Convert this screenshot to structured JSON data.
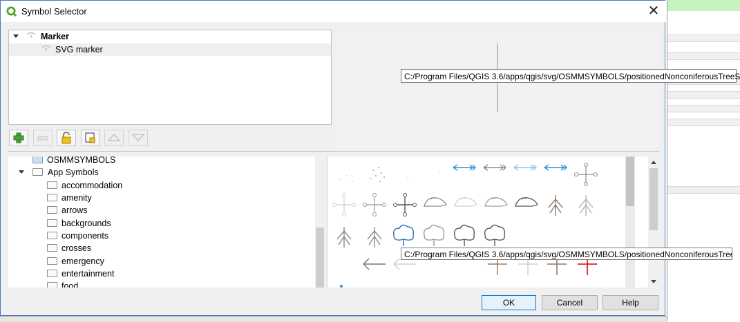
{
  "dialog": {
    "title": "Symbol Selector",
    "close_glyph": "✕"
  },
  "layer_tree": {
    "root_label": "Marker",
    "child_label": "SVG marker"
  },
  "toolbar": {
    "icons": [
      "add-layer-icon",
      "remove-layer-icon",
      "lock-icon",
      "duplicate-icon",
      "move-up-icon",
      "move-down-icon"
    ]
  },
  "tooltips": {
    "symbol_path": "C:/Program Files/QGIS 3.6/apps/qgis/svg/OSMMSYMBOLS/positionedNonconiferousTreeS",
    "symbol_path_preview": "C:/Program Files/QGIS 3.6/apps/qgis/svg/OSMMSYMBOLS/positionedNonconiferousTreeS"
  },
  "folder_tree": {
    "items": [
      {
        "label": "OSMMSYMBOLS",
        "expanded": null
      },
      {
        "label": "App Symbols",
        "expanded": true
      },
      {
        "label": "accommodation"
      },
      {
        "label": "amenity"
      },
      {
        "label": "arrows"
      },
      {
        "label": "backgrounds"
      },
      {
        "label": "components"
      },
      {
        "label": "crosses"
      },
      {
        "label": "emergency"
      },
      {
        "label": "entertainment"
      },
      {
        "label": "food"
      }
    ]
  },
  "symbols": {
    "rows": [
      [
        "dots-faint",
        "dots-scatter",
        "dots-faint",
        "dots-faint",
        "arrow-left-double-blue",
        "arrow-left-double-grey",
        "arrow-left-double-lightblue",
        "arrow-left-double-blue",
        "cross-circles-grey"
      ],
      [
        "cross-circles-faint",
        "cross-circles-grey",
        "cross-circles-dark",
        "mouse-outline-grey",
        "mouse-outline-faint",
        "mouse-outline-grey",
        "mouse-outline-dark",
        "conifer-tree-brown",
        "conifer-tree-grey"
      ],
      [
        "conifer-tree-grey",
        "conifer-tree-grey",
        "broadleaf-tree-blue",
        "broadleaf-tree-grey",
        "broadleaf-tree-dark",
        "broadleaf-tree-dark"
      ],
      [
        "arrow-left-grey",
        "arrow-left-faint",
        "arrow-left-faint",
        "arrow-left-dark",
        "cross-brown",
        "cross-faint",
        "cross-brown",
        "cross-red"
      ]
    ],
    "colors": {
      "blue": "#2a8fd8",
      "grey": "#8a8a8a",
      "dark": "#555555",
      "brown": "#9b7a62",
      "red": "#e0201c",
      "faint": "#cfcfcf"
    }
  },
  "buttons": {
    "ok": "OK",
    "cancel": "Cancel",
    "help": "Help"
  },
  "colors": {
    "accent": "#0078d7",
    "title_icon": "#5aa02c"
  }
}
